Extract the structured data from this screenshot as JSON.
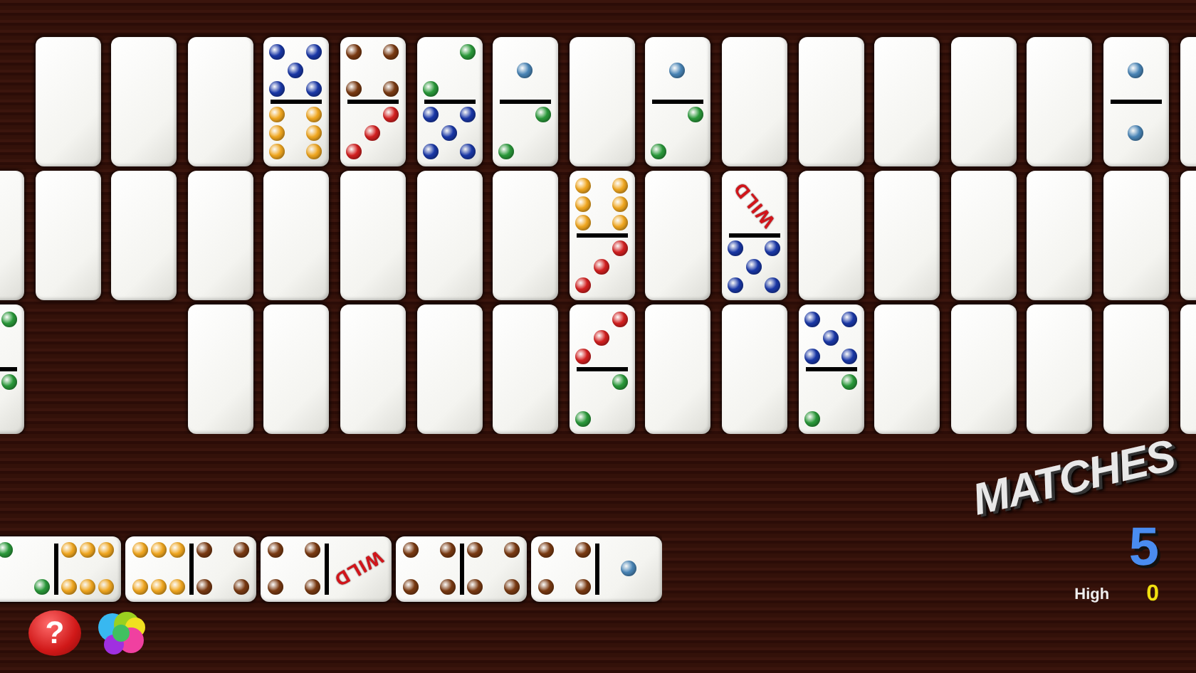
{
  "board": {
    "rows": [
      {
        "tiles": [
          {
            "kind": "gap"
          },
          {
            "kind": "hidden"
          },
          {
            "kind": "hidden"
          },
          {
            "kind": "hidden"
          },
          {
            "kind": "face",
            "top": {
              "kind": "five"
            },
            "bottom": {
              "kind": "six"
            }
          },
          {
            "kind": "face",
            "top": {
              "kind": "four"
            },
            "bottom": {
              "kind": "three"
            }
          },
          {
            "kind": "face",
            "top": {
              "kind": "two"
            },
            "bottom": {
              "kind": "five"
            }
          },
          {
            "kind": "face",
            "top": {
              "kind": "one"
            },
            "bottom": {
              "kind": "two"
            }
          },
          {
            "kind": "hidden"
          },
          {
            "kind": "face",
            "top": {
              "kind": "one"
            },
            "bottom": {
              "kind": "two"
            }
          },
          {
            "kind": "hidden"
          },
          {
            "kind": "hidden"
          },
          {
            "kind": "hidden"
          },
          {
            "kind": "hidden"
          },
          {
            "kind": "hidden"
          },
          {
            "kind": "face",
            "top": {
              "kind": "one"
            },
            "bottom": {
              "kind": "one"
            }
          },
          {
            "kind": "hidden"
          }
        ]
      },
      {
        "tiles": [
          {
            "kind": "hidden"
          },
          {
            "kind": "hidden"
          },
          {
            "kind": "hidden"
          },
          {
            "kind": "hidden"
          },
          {
            "kind": "hidden"
          },
          {
            "kind": "hidden"
          },
          {
            "kind": "hidden"
          },
          {
            "kind": "hidden"
          },
          {
            "kind": "face",
            "top": {
              "kind": "six"
            },
            "bottom": {
              "kind": "three"
            }
          },
          {
            "kind": "hidden"
          },
          {
            "kind": "face",
            "top": {
              "kind": "wild",
              "text": "WILD"
            },
            "bottom": {
              "kind": "five"
            }
          },
          {
            "kind": "hidden"
          },
          {
            "kind": "hidden"
          },
          {
            "kind": "hidden"
          },
          {
            "kind": "hidden"
          },
          {
            "kind": "hidden"
          },
          {
            "kind": "hidden"
          }
        ]
      },
      {
        "tiles": [
          {
            "kind": "face",
            "top": {
              "kind": "two"
            },
            "bottom": {
              "kind": "two"
            }
          },
          {
            "kind": "gap"
          },
          {
            "kind": "gap"
          },
          {
            "kind": "hidden"
          },
          {
            "kind": "hidden"
          },
          {
            "kind": "hidden"
          },
          {
            "kind": "hidden"
          },
          {
            "kind": "hidden"
          },
          {
            "kind": "face",
            "top": {
              "kind": "three"
            },
            "bottom": {
              "kind": "two"
            }
          },
          {
            "kind": "hidden"
          },
          {
            "kind": "hidden"
          },
          {
            "kind": "face",
            "top": {
              "kind": "five"
            },
            "bottom": {
              "kind": "two"
            }
          },
          {
            "kind": "hidden"
          },
          {
            "kind": "hidden"
          },
          {
            "kind": "hidden"
          },
          {
            "kind": "hidden"
          },
          {
            "kind": "hidden"
          }
        ]
      }
    ]
  },
  "hand": [
    {
      "left": {
        "kind": "two"
      },
      "right": {
        "kind": "six"
      }
    },
    {
      "left": {
        "kind": "six"
      },
      "right": {
        "kind": "four"
      }
    },
    {
      "left": {
        "kind": "four"
      },
      "right": {
        "kind": "wild",
        "text": "WILD"
      }
    },
    {
      "left": {
        "kind": "four"
      },
      "right": {
        "kind": "four"
      }
    },
    {
      "left": {
        "kind": "four"
      },
      "right": {
        "kind": "one"
      }
    }
  ],
  "help_button": {
    "label": "?"
  },
  "score": {
    "title": "MATCHES",
    "value": "5",
    "high_label": "High",
    "high_value": "0"
  }
}
